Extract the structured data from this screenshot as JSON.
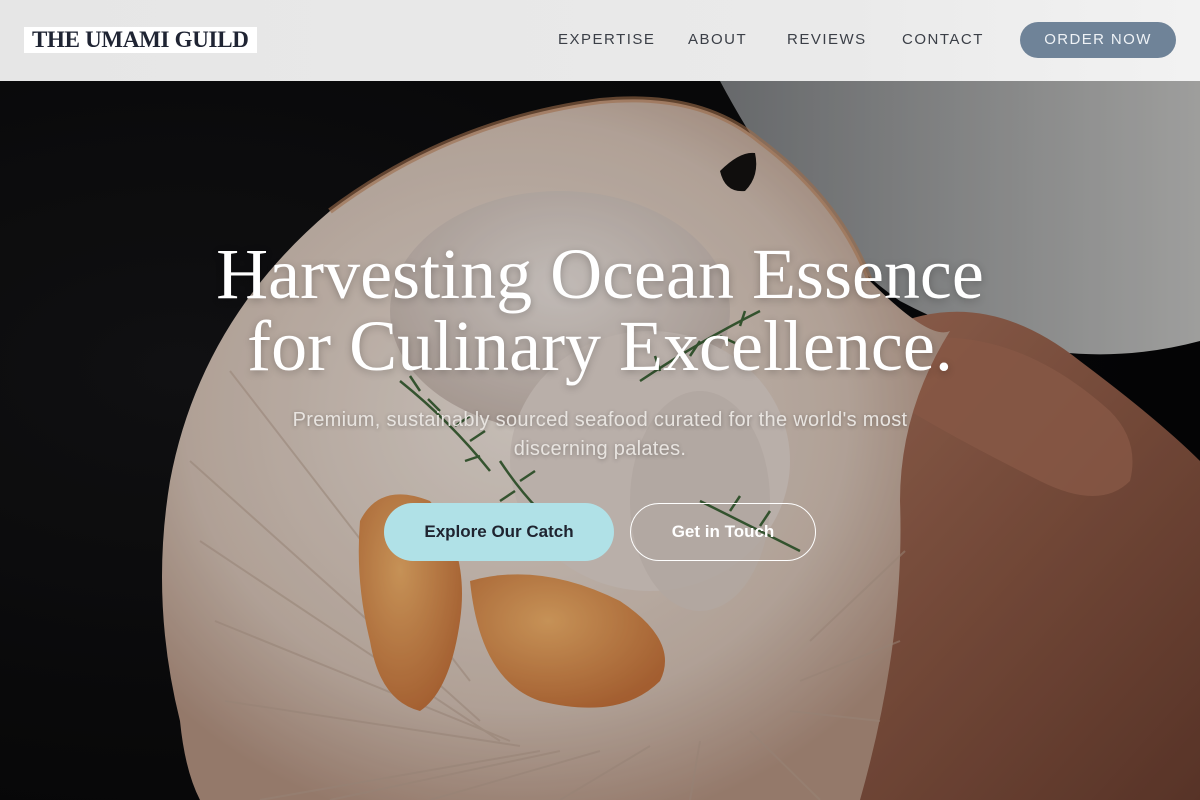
{
  "header": {
    "logo": "THE UMAMI GUILD",
    "nav": {
      "expertise": "EXPERTISE",
      "about": "ABOUT",
      "reviews": "REVIEWS",
      "contact": "CONTACT"
    },
    "cta": "ORDER NOW"
  },
  "hero": {
    "title_line1": "Harvesting Ocean Essence",
    "title_line2": "for Culinary Excellence.",
    "subtitle": "Premium, sustainably sourced seafood curated for the world's most discerning palates.",
    "primary_button": "Explore Our Catch",
    "secondary_button": "Get in Touch",
    "image": "scallop-shell-photo"
  },
  "colors": {
    "accent": "#6f8398",
    "primary_button": "#b0e1e7",
    "logo_text": "#1f2433"
  }
}
